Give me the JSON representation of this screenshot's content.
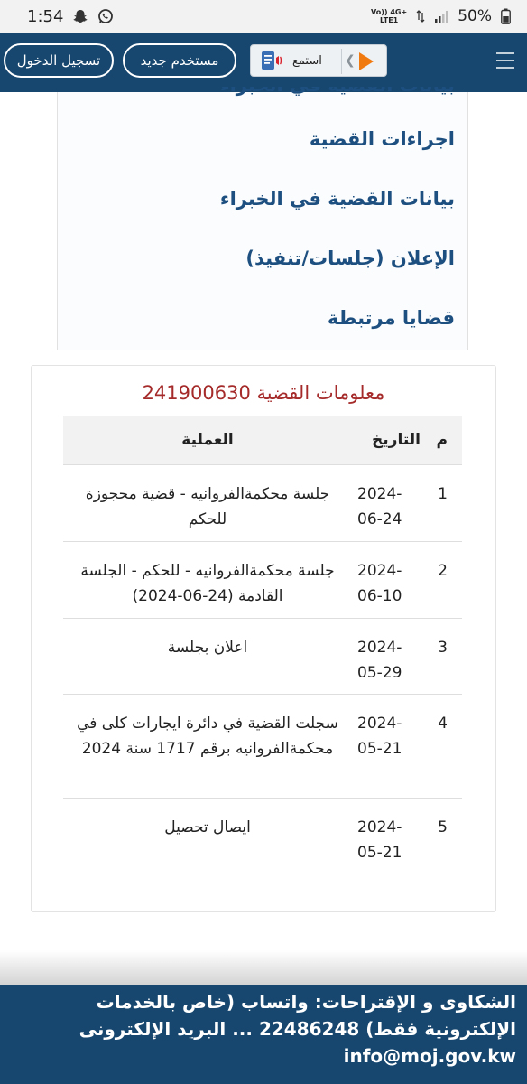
{
  "status_bar": {
    "time": "1:54",
    "battery": "50%",
    "net_top": "Vo)) 4G+",
    "net_bottom": "LTE1"
  },
  "header": {
    "login_label": "تسجيل الدخول",
    "register_label": "مستخدم جديد",
    "listen_label": "استمع"
  },
  "links": {
    "cut_item": "بيانات القضية في الخبراء",
    "items": [
      "اجراءات القضية",
      "بيانات القضية في الخبراء",
      "الإعلان (جلسات/تنفيذ)",
      "قضايا مرتبطة"
    ]
  },
  "case": {
    "title": "معلومات القضية 241900630",
    "columns": {
      "n": "م",
      "date": "التاريخ",
      "op": "العملية"
    },
    "rows": [
      {
        "n": "1",
        "date": "2024-06-24",
        "op": "جلسة محكمةالفروانيه - قضية محجوزة للحكم"
      },
      {
        "n": "2",
        "date": "2024-06-10",
        "op": "جلسة محكمةالفروانيه - للحكم - الجلسة القادمة (24-06-2024)"
      },
      {
        "n": "3",
        "date": "2024-05-29",
        "op": "اعلان بجلسة"
      },
      {
        "n": "4",
        "date": "2024-05-21",
        "op": "سجلت القضية في دائرة ايجارات كلى في محكمةالفروانيه برقم 1717 سنة 2024"
      },
      {
        "n": "5",
        "date": "2024-05-21",
        "op": "ايصال تحصيل"
      }
    ]
  },
  "footer": {
    "text": "الشكاوى و الإقتراحات: واتساب (خاص بالخدمات الإلكترونية فقط) 22486248 ... البريد الإلكترونى info@moj.gov.kw"
  }
}
